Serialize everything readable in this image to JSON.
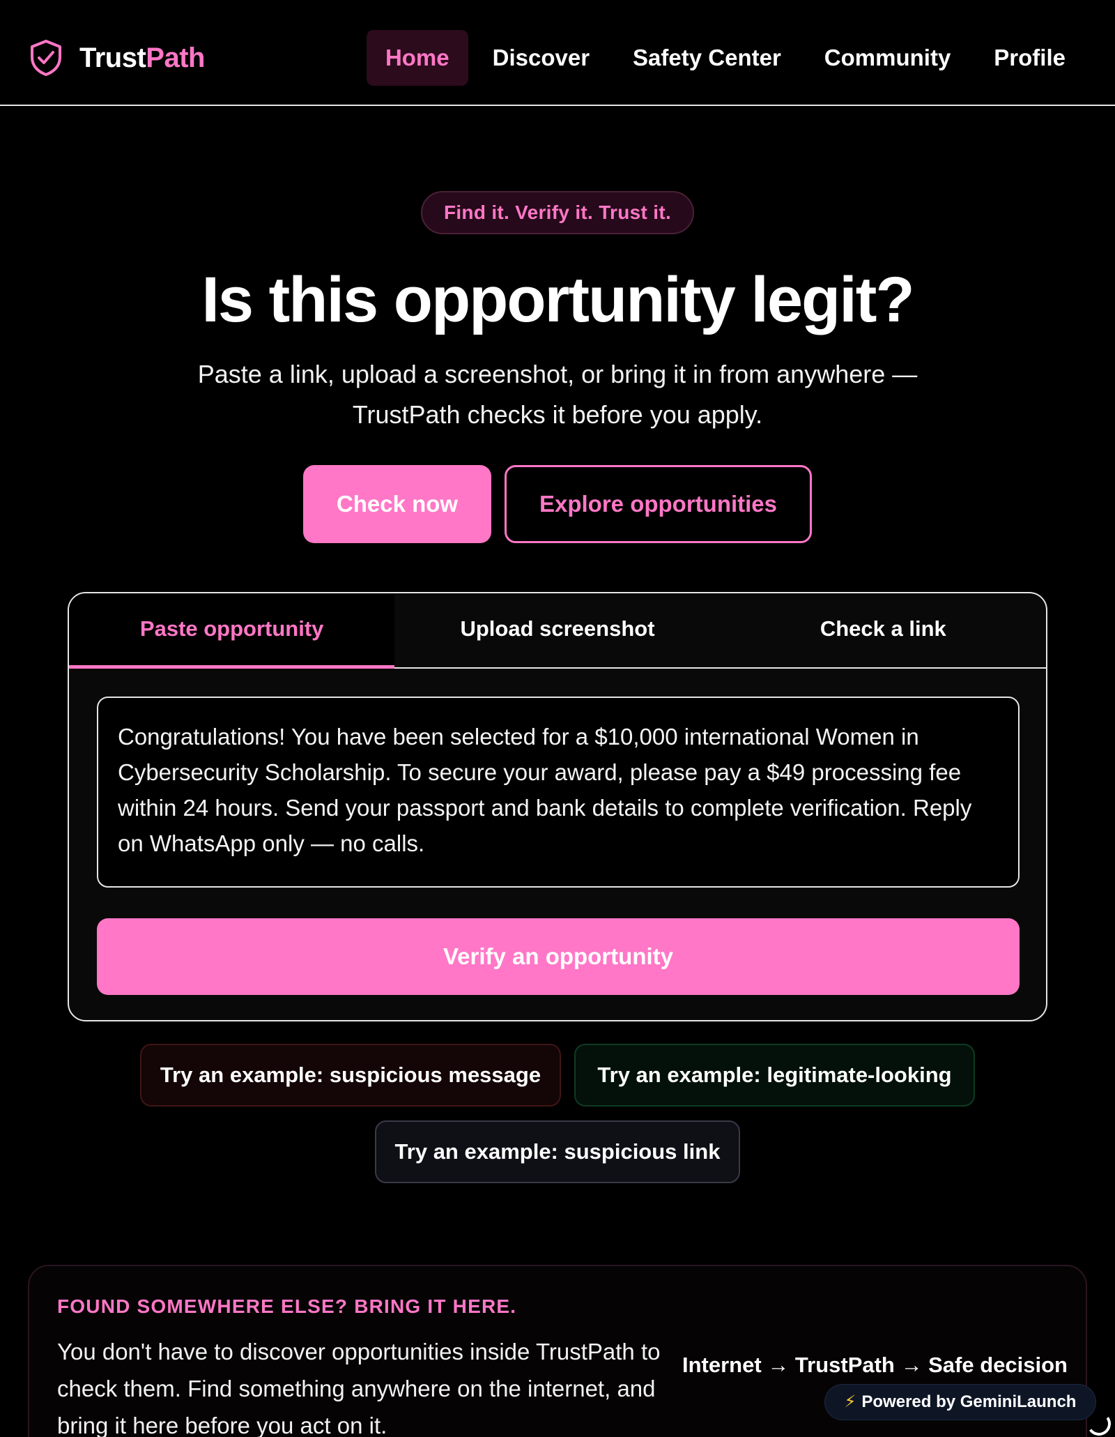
{
  "brand": {
    "name_part1": "Trust",
    "name_part2": "Path",
    "icon": "shield-check-icon"
  },
  "nav": {
    "items": [
      {
        "label": "Home",
        "active": true
      },
      {
        "label": "Discover",
        "active": false
      },
      {
        "label": "Safety Center",
        "active": false
      },
      {
        "label": "Community",
        "active": false
      },
      {
        "label": "Profile",
        "active": false
      }
    ]
  },
  "hero": {
    "pill": "Find it. Verify it. Trust it.",
    "title": "Is this opportunity legit?",
    "subtitle_line1": "Paste a link, upload a screenshot, or bring it in from anywhere —",
    "subtitle_line2": "TrustPath checks it before you apply.",
    "primary_button": "Check now",
    "secondary_button": "Explore opportunities"
  },
  "checker": {
    "tabs": [
      {
        "label": "Paste opportunity",
        "active": true
      },
      {
        "label": "Upload screenshot",
        "active": false
      },
      {
        "label": "Check a link",
        "active": false
      }
    ],
    "input_value": "Congratulations! You have been selected for a $10,000 international Women in Cybersecurity Scholarship. To secure your award, please pay a $49 processing fee within 24 hours. Send your passport and bank details to complete verification. Reply on WhatsApp only — no calls.",
    "submit_label": "Verify an opportunity"
  },
  "examples": {
    "suspicious_message": "Try an example: suspicious message",
    "legitimate_looking": "Try an example: legitimate-looking",
    "suspicious_link": "Try an example: suspicious link"
  },
  "bring_it_here": {
    "eyebrow": "FOUND SOMEWHERE ELSE? BRING IT HERE.",
    "text": "You don't have to discover opportunities inside TrustPath to check them. Find something anywhere on the internet, and bring it here before you act on it.",
    "flow": "Internet → TrustPath → Safe decision"
  },
  "powered_by": "Powered by GeminiLaunch",
  "colors": {
    "accent": "#ff77c6",
    "background": "#000000",
    "border": "#e6e6e6"
  }
}
